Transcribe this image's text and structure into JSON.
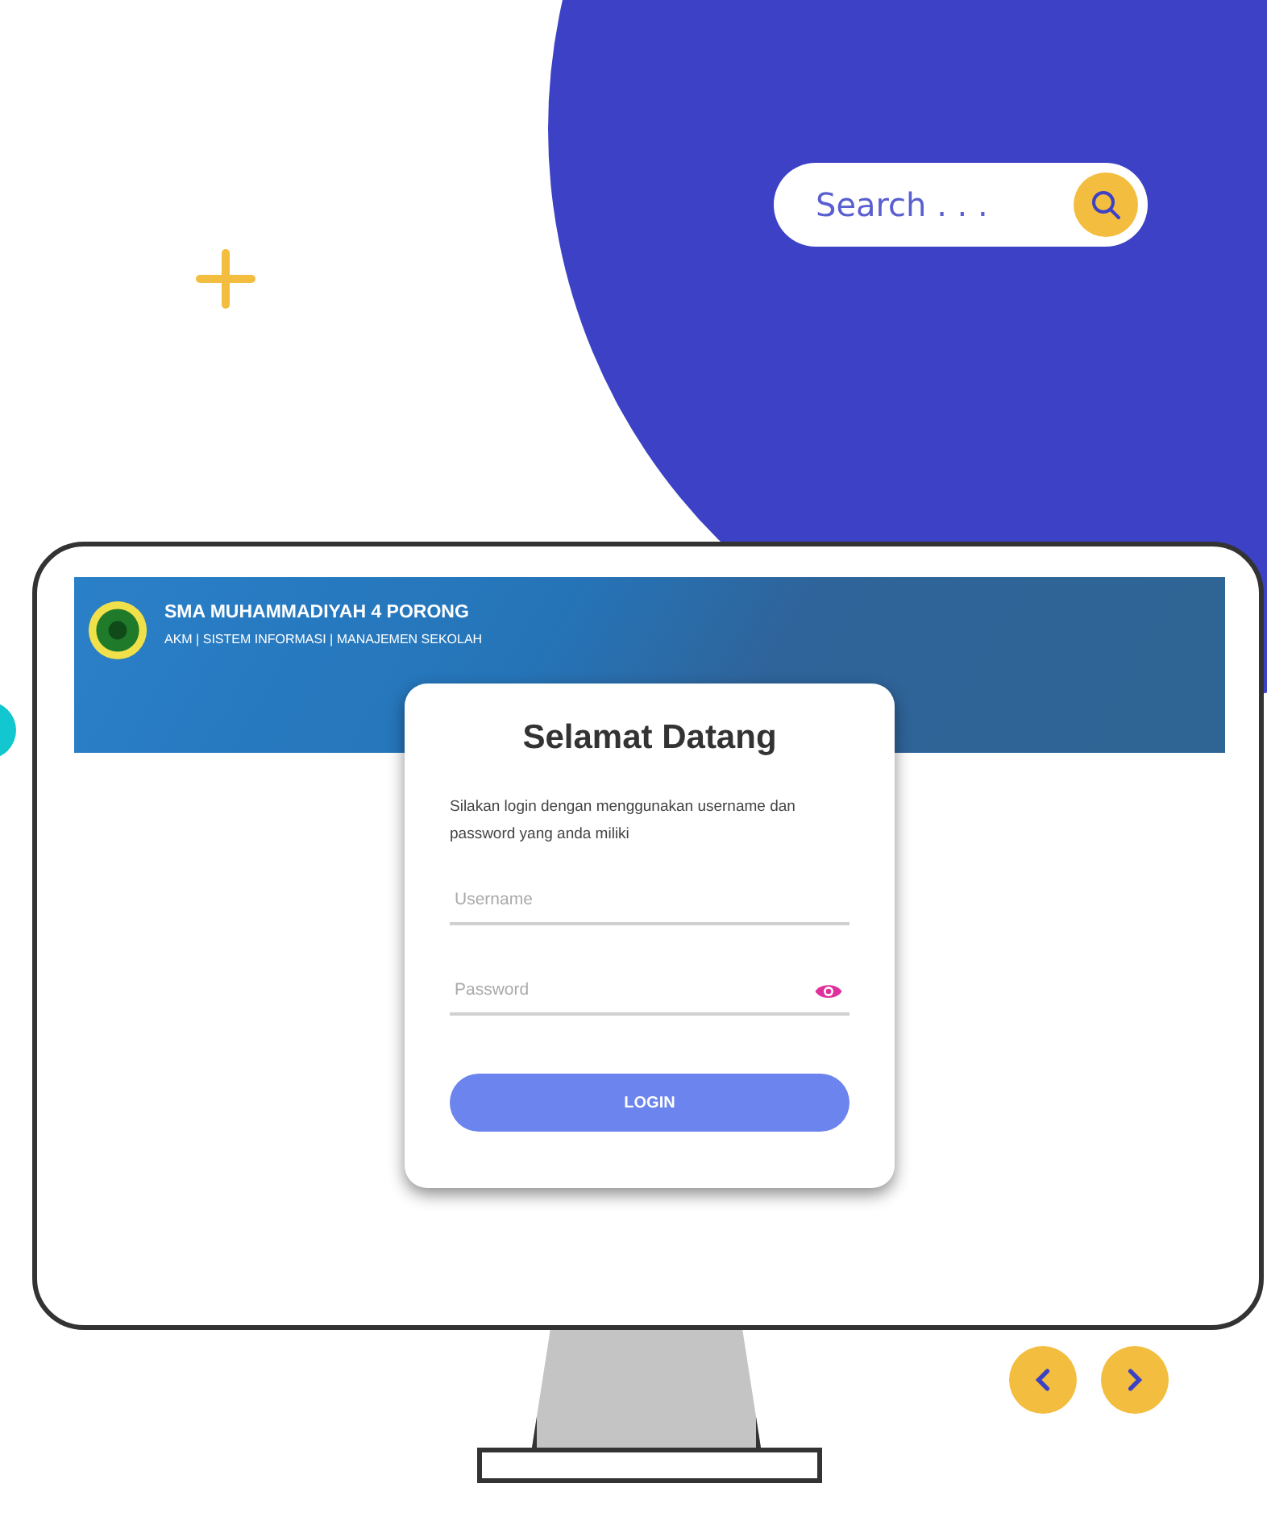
{
  "search": {
    "placeholder": "Search . . ."
  },
  "header": {
    "title": "SMA MUHAMMADIYAH 4 PORONG",
    "subtitle": "AKM | SISTEM INFORMASI | MANAJEMEN SEKOLAH"
  },
  "login": {
    "title": "Selamat Datang",
    "description": "Silakan login dengan menggunakan username dan password yang anda miliki",
    "username": {
      "placeholder": "Username"
    },
    "password": {
      "placeholder": "Password"
    },
    "button": "LOGIN"
  }
}
